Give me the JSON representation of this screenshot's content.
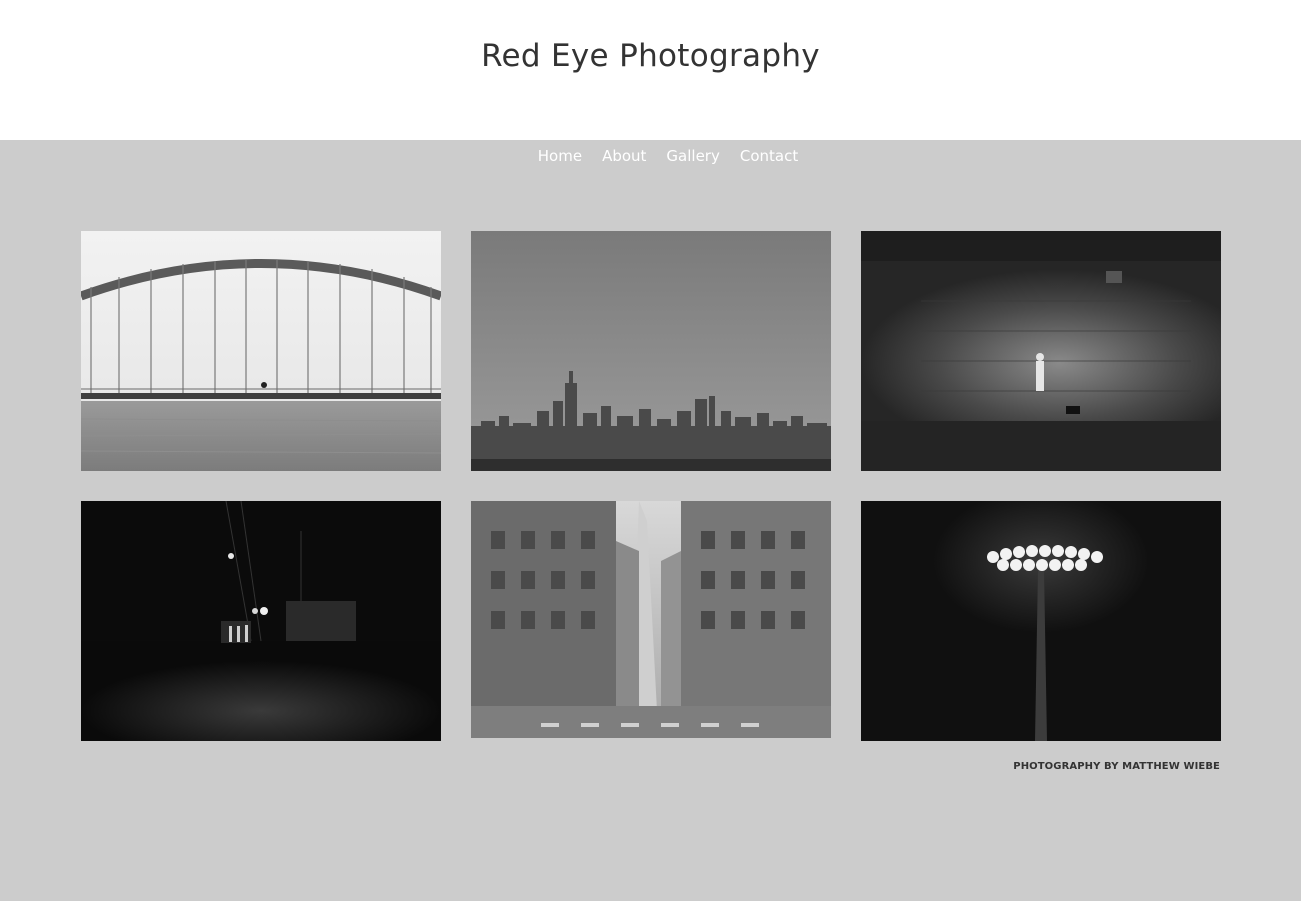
{
  "site": {
    "title": "Red Eye Photography"
  },
  "nav": {
    "items": [
      {
        "label": "Home"
      },
      {
        "label": "About"
      },
      {
        "label": "Gallery"
      },
      {
        "label": "Contact"
      }
    ]
  },
  "gallery": {
    "photos": [
      {
        "subject": "arch-bridge-over-water"
      },
      {
        "subject": "city-skyline"
      },
      {
        "subject": "child-and-dog-by-stone-wall"
      },
      {
        "subject": "night-street-construction"
      },
      {
        "subject": "street-with-skyscraper"
      },
      {
        "subject": "stadium-floodlight"
      }
    ]
  },
  "footer": {
    "credit": "PHOTOGRAPHY BY MATTHEW WIEBE"
  },
  "colors": {
    "header_bg": "#ffffff",
    "page_bg": "#cccccc",
    "title_text": "#333333",
    "nav_text": "#ffffff"
  }
}
